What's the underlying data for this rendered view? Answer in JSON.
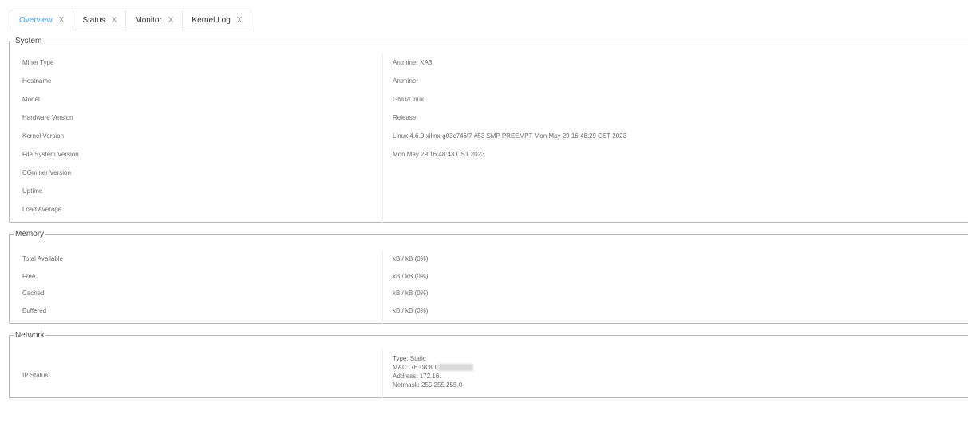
{
  "tabs": [
    {
      "label": "Overview",
      "close": "X",
      "active": true
    },
    {
      "label": "Status",
      "close": "X",
      "active": false
    },
    {
      "label": "Monitor",
      "close": "X",
      "active": false
    },
    {
      "label": "Kernel Log",
      "close": "X",
      "active": false
    }
  ],
  "system": {
    "legend": "System",
    "rows": [
      {
        "label": "Miner Type",
        "value": "Antminer KA3"
      },
      {
        "label": "Hostname",
        "value": "Antminer"
      },
      {
        "label": "Model",
        "value": "GNU/Linux"
      },
      {
        "label": "Hardware Version",
        "value": "Release"
      },
      {
        "label": "Kernel Version",
        "value": "Linux 4.6.0-xilinx-g03c746f7 #53 SMP PREEMPT Mon May 29 16:48:29 CST 2023"
      },
      {
        "label": "File System Version",
        "value": "Mon May 29 16:48:43 CST 2023"
      },
      {
        "label": "CGminer Version",
        "value": ""
      },
      {
        "label": "Uptime",
        "value": ""
      },
      {
        "label": "Load Average",
        "value": ""
      }
    ]
  },
  "memory": {
    "legend": "Memory",
    "rows": [
      {
        "label": "Total Available",
        "value": "kB / kB (0%)"
      },
      {
        "label": "Free",
        "value": "kB / kB (0%)"
      },
      {
        "label": "Cached",
        "value": "kB / kB (0%)"
      },
      {
        "label": "Buffered",
        "value": "kB / kB (0%)"
      }
    ]
  },
  "network": {
    "legend": "Network",
    "label": "IP Status",
    "type": "Type: Static",
    "mac": "MAC: 7E:08:80:",
    "address": "Address: 172.16.",
    "netmask": "Netmask: 255.255.255.0"
  }
}
